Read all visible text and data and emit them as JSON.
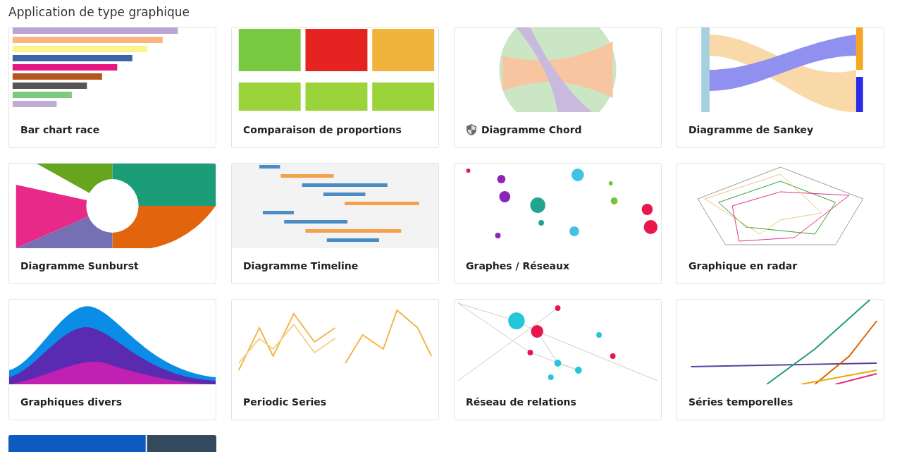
{
  "heading": "Application de type graphique",
  "cards": [
    {
      "title": "Bar chart race",
      "restricted": false
    },
    {
      "title": "Comparaison de proportions",
      "restricted": false
    },
    {
      "title": "Diagramme Chord",
      "restricted": true
    },
    {
      "title": "Diagramme de Sankey",
      "restricted": false
    },
    {
      "title": "Diagramme Sunburst",
      "restricted": false
    },
    {
      "title": "Diagramme Timeline",
      "restricted": false
    },
    {
      "title": "Graphes / Réseaux",
      "restricted": false
    },
    {
      "title": "Graphique en radar",
      "restricted": false
    },
    {
      "title": "Graphiques divers",
      "restricted": false
    },
    {
      "title": "Periodic Series",
      "restricted": false
    },
    {
      "title": "Réseau de relations",
      "restricted": false
    },
    {
      "title": "Séries temporelles",
      "restricted": false
    },
    {
      "kind": "picture"
    }
  ]
}
